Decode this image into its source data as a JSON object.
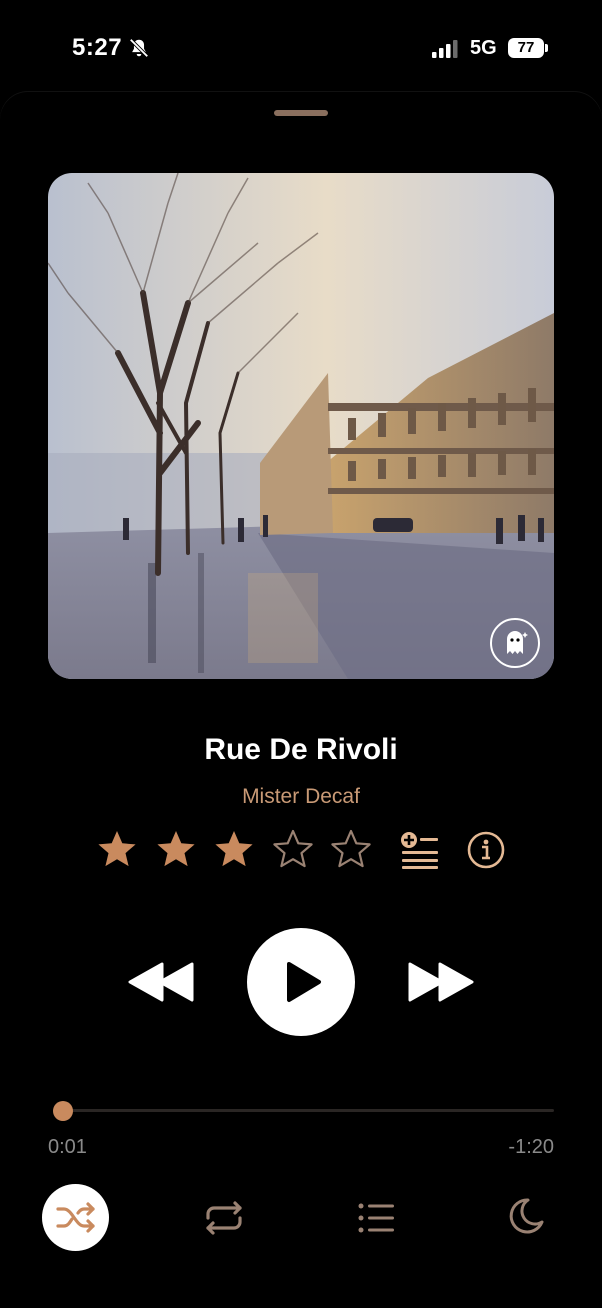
{
  "status_bar": {
    "time": "5:27",
    "network": "5G",
    "battery": "77",
    "icons": [
      "bell-slash-icon",
      "signal-icon"
    ]
  },
  "now_playing": {
    "title": "Rue De Rivoli",
    "artist": "Mister Decaf",
    "rating": 3,
    "rating_max": 5,
    "artwork_badge_icon": "ghost-icon"
  },
  "progress": {
    "elapsed": "0:01",
    "remaining": "-1:20",
    "fraction": 0.01
  },
  "controls": {
    "rating_actions": [
      "queue-add-icon",
      "info-icon"
    ],
    "transport": [
      "rewind-icon",
      "play-icon",
      "fast-forward-icon"
    ],
    "bottom_bar": [
      "shuffle-icon",
      "repeat-icon",
      "queue-list-icon",
      "moon-icon"
    ]
  },
  "colors": {
    "accent": "#c98a5e",
    "artist_text": "#c99a76",
    "background": "#000000"
  }
}
